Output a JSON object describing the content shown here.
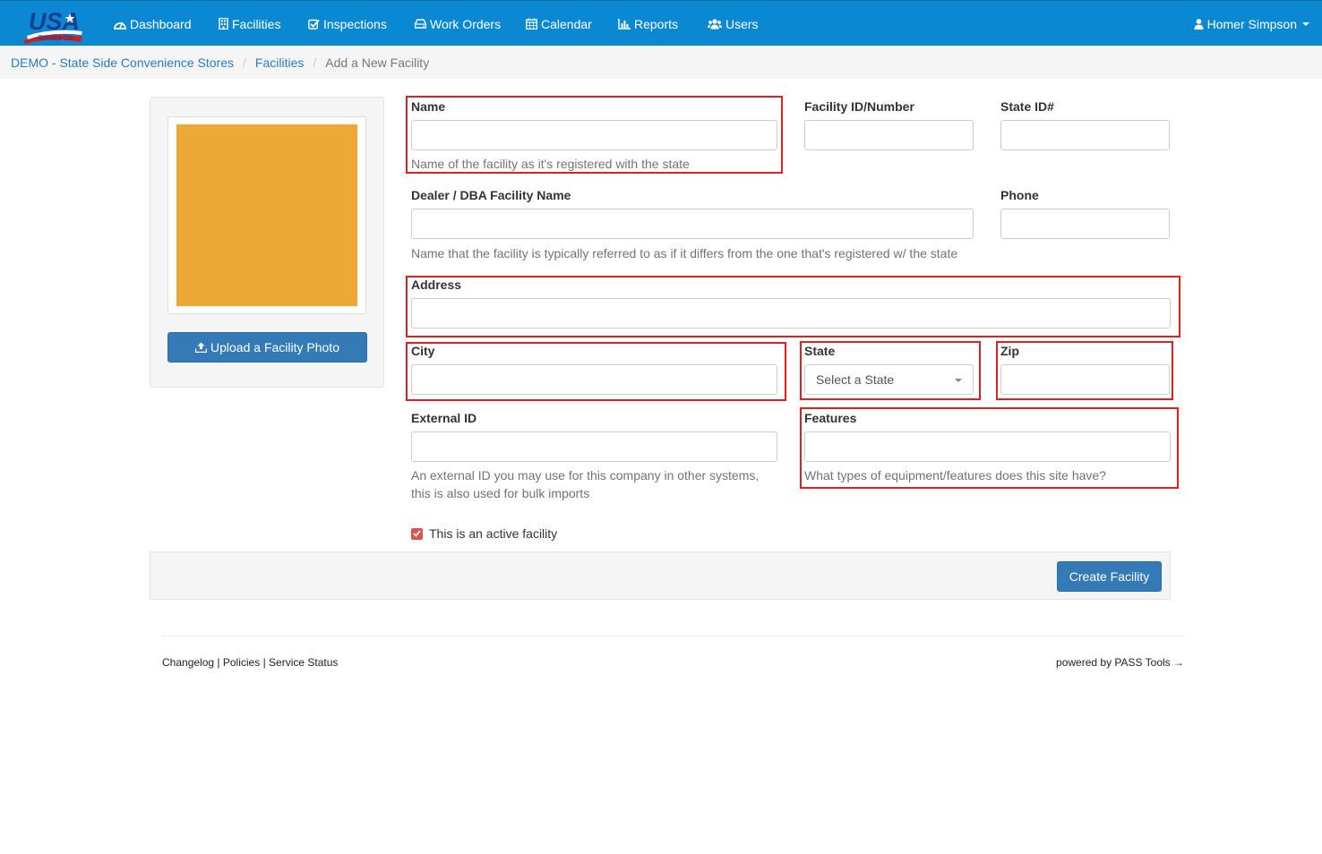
{
  "navbar": {
    "logo_text": "USA",
    "logo_subtext": "Service Co.",
    "items": [
      {
        "label": "Dashboard",
        "icon": "dashboard-icon"
      },
      {
        "label": "Facilities",
        "icon": "building-icon"
      },
      {
        "label": "Inspections",
        "icon": "check-square-icon"
      },
      {
        "label": "Work Orders",
        "icon": "hdd-icon"
      },
      {
        "label": "Calendar",
        "icon": "calendar-icon"
      },
      {
        "label": "Reports",
        "icon": "bar-chart-icon"
      },
      {
        "label": "Users",
        "icon": "users-icon"
      }
    ],
    "user": "Homer Simpson",
    "user_icon": "user-icon",
    "colors": {
      "bar": "#0a89d2"
    }
  },
  "breadcrumb": {
    "items": [
      "DEMO - State Side Convenience Stores",
      "Facilities"
    ],
    "current": "Add a New Facility"
  },
  "photo": {
    "upload_label": "Upload a Facility Photo",
    "upload_icon": "upload-icon",
    "placeholder_color": "#eea835"
  },
  "form": {
    "name": {
      "label": "Name",
      "value": "",
      "help": "Name of the facility as it's registered with the state"
    },
    "facility_id": {
      "label": "Facility ID/Number",
      "value": ""
    },
    "state_id": {
      "label": "State ID#",
      "value": ""
    },
    "dba": {
      "label": "Dealer / DBA Facility Name",
      "value": "",
      "help": "Name that the facility is typically referred to as if it differs from the one that's registered w/ the state"
    },
    "phone": {
      "label": "Phone",
      "value": ""
    },
    "address": {
      "label": "Address",
      "value": ""
    },
    "city": {
      "label": "City",
      "value": ""
    },
    "state": {
      "label": "State",
      "selected": "Select a State"
    },
    "zip": {
      "label": "Zip",
      "value": ""
    },
    "external_id": {
      "label": "External ID",
      "value": "",
      "help_line1": "An external ID you may use for this company in other systems,",
      "help_line2": "this is also used for bulk imports"
    },
    "features": {
      "label": "Features",
      "value": "",
      "help": "What types of equipment/features does this site have?"
    },
    "active": {
      "label": "This is an active facility",
      "checked": true
    },
    "submit_label": "Create Facility"
  },
  "highlight_color": "#e0201e",
  "footer": {
    "links": [
      "Changelog",
      "Policies",
      "Service Status"
    ],
    "separator": "|",
    "powered_by": "powered by PASS Tools →"
  }
}
